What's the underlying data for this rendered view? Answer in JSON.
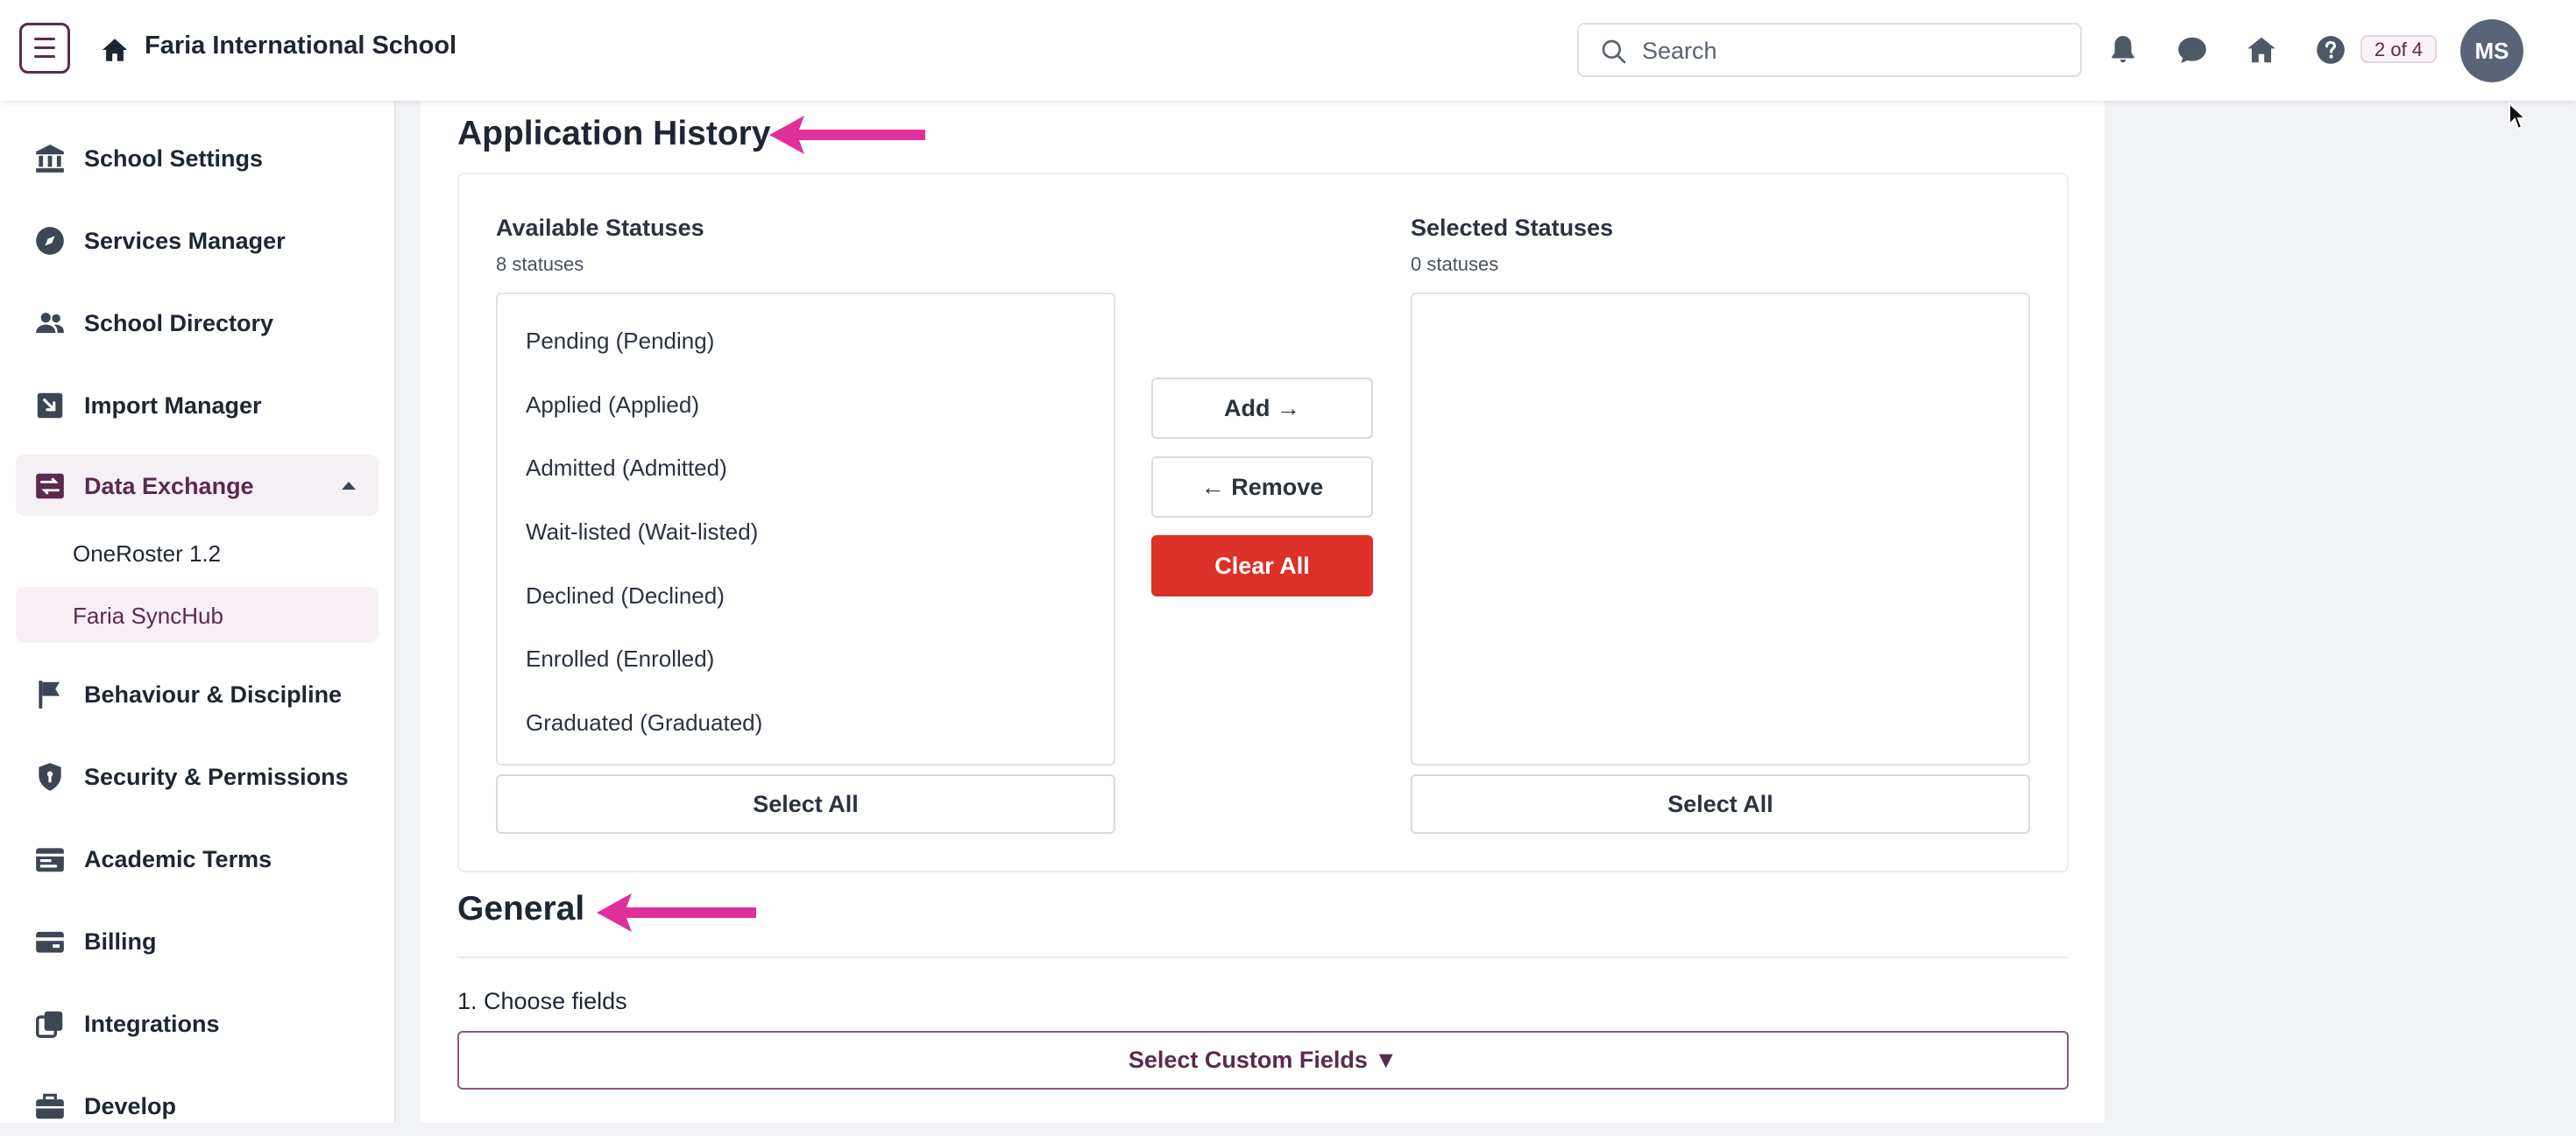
{
  "header": {
    "school_name": "Faria International School",
    "search_placeholder": "Search",
    "counter": "2 of 4",
    "avatar_initials": "MS"
  },
  "sidebar": {
    "items": [
      {
        "label": "School Settings",
        "icon": "bank-icon"
      },
      {
        "label": "Services Manager",
        "icon": "compass-icon"
      },
      {
        "label": "School Directory",
        "icon": "people-icon"
      },
      {
        "label": "Import Manager",
        "icon": "import-icon"
      },
      {
        "label": "Data Exchange",
        "icon": "data-exchange-icon",
        "expanded": true
      },
      {
        "label": "Behaviour & Discipline",
        "icon": "flag-icon"
      },
      {
        "label": "Security & Permissions",
        "icon": "shield-icon"
      },
      {
        "label": "Academic Terms",
        "icon": "calendar-icon"
      },
      {
        "label": "Billing",
        "icon": "wallet-icon"
      },
      {
        "label": "Integrations",
        "icon": "layers-icon"
      },
      {
        "label": "Develop",
        "icon": "briefcase-icon"
      }
    ],
    "subitems": [
      {
        "label": "OneRoster 1.2"
      },
      {
        "label": "Faria SyncHub",
        "active": true
      }
    ]
  },
  "main": {
    "application_history": {
      "title": "Application History",
      "available": {
        "title": "Available Statuses",
        "count": "8 statuses",
        "options": [
          "Pending (Pending)",
          "Applied (Applied)",
          "Admitted (Admitted)",
          "Wait-listed (Wait-listed)",
          "Declined (Declined)",
          "Enrolled (Enrolled)",
          "Graduated (Graduated)"
        ],
        "select_all": "Select All"
      },
      "selected": {
        "title": "Selected Statuses",
        "count": "0 statuses",
        "options": [],
        "select_all": "Select All"
      },
      "add_label": "Add →",
      "remove_label": "← Remove",
      "clear_label": "Clear All"
    },
    "general": {
      "title": "General",
      "choose_fields": "1. Choose fields",
      "custom_fields_button": "Select Custom Fields ▼"
    }
  },
  "colors": {
    "brand": "#5b2a4e",
    "danger": "#dc3028",
    "annotation_arrow": "#e0309a"
  }
}
